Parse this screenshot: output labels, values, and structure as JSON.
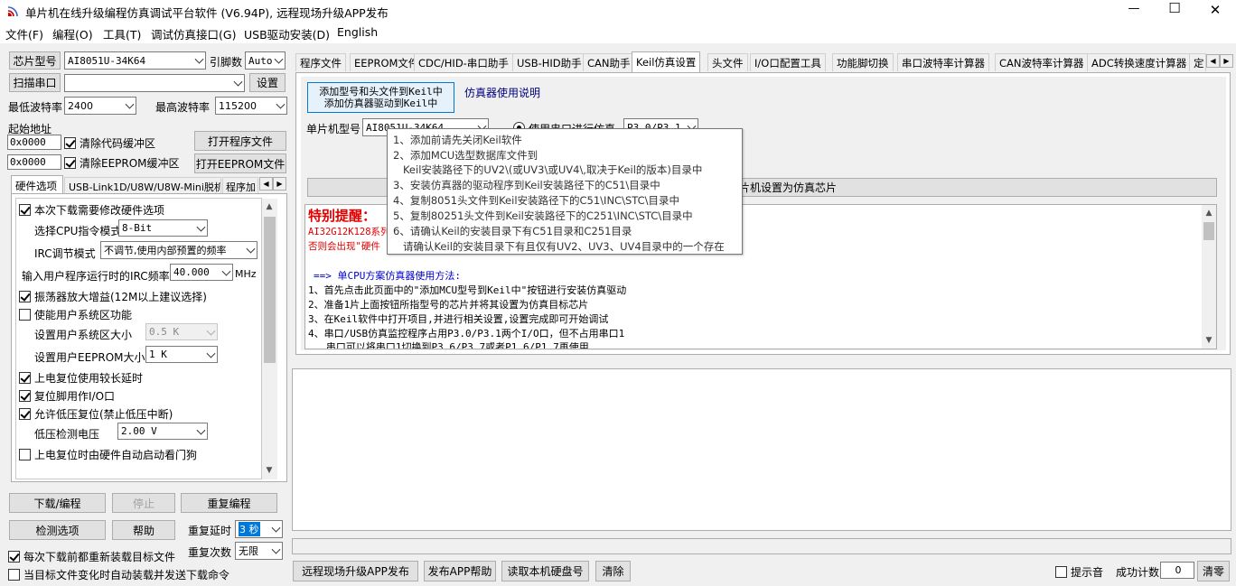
{
  "window": {
    "title": "单片机在线升级编程仿真调试平台软件 (V6.94P), 远程现场升级APP发布",
    "minimize": "—",
    "maximize": "☐",
    "close": "✕"
  },
  "menu": [
    "文件(F)",
    "编程(O)",
    "工具(T)",
    "调试仿真接口(G)",
    "USB驱动安装(D)",
    "English"
  ],
  "left": {
    "chip_label": "芯片型号",
    "chip_value": "AI8051U-34K64",
    "pins_label": "引脚数",
    "pins_value": "Auto",
    "scan_port": "扫描串口",
    "port_value": "",
    "settings": "设置",
    "min_baud_label": "最低波特率",
    "min_baud": "2400",
    "max_baud_label": "最高波特率",
    "max_baud": "115200",
    "start_addr_label": "起始地址",
    "code_addr": "0x0000",
    "clear_code": "清除代码缓冲区",
    "open_program": "打开程序文件",
    "eeprom_addr": "0x0000",
    "clear_eeprom": "清除EEPROM缓冲区",
    "open_eeprom": "打开EEPROM文件",
    "subtabs": [
      "硬件选项",
      "USB-Link1D/U8W/U8W-Mini脱机",
      "程序加"
    ],
    "hw": {
      "modify": "本次下载需要修改硬件选项",
      "cpu_mode_label": "选择CPU指令模式",
      "cpu_mode": "8-Bit",
      "irc_label": "IRC调节模式",
      "irc_value": "不调节,使用内部预置的频率",
      "freq_label": "输入用户程序运行时的IRC频率",
      "freq_value": "40.000",
      "freq_unit": "MHz",
      "osc_gain": "振荡器放大增益(12M以上建议选择)",
      "user_sys": "使能用户系统区功能",
      "sys_size_label": "设置用户系统区大小",
      "sys_size": "0.5 K",
      "eeprom_size_label": "设置用户EEPROM大小",
      "eeprom_size": "1  K",
      "long_delay": "上电复位使用较长延时",
      "reset_io": "复位脚用作I/O口",
      "low_volt_reset": "允许低压复位(禁止低压中断)",
      "low_volt_label": "低压检测电压",
      "low_volt": "2.00 V",
      "watchdog": "上电复位时由硬件自动启动看门狗"
    },
    "download": "下载/编程",
    "stop": "停止",
    "reprogram": "重复编程",
    "check": "检测选项",
    "help": "帮助",
    "delay_label": "重复延时",
    "delay_value": "3 秒",
    "count_label": "重复次数",
    "count_value": "无限",
    "reload": "每次下载前都重新装载目标文件",
    "auto_send": "当目标文件变化时自动装载并发送下载命令"
  },
  "tabs": [
    "程序文件",
    "EEPROM文件",
    "CDC/HID-串口助手",
    "USB-HID助手",
    "CAN助手",
    "Keil仿真设置",
    "头文件",
    "I/O口配置工具",
    "功能脚切换",
    "串口波特率计算器",
    "CAN波特率计算器",
    "ADC转换速度计算器",
    "定"
  ],
  "keil": {
    "add_btn_line1": "添加型号和头文件到Keil中",
    "add_btn_line2": "添加仿真器驱动到Keil中",
    "usage_link": "仿真器使用说明",
    "mcu_label": "单片机型号",
    "mcu_value": "AI8051U-34K64",
    "serial_label": "使用串口进行仿真",
    "serial_value": "P3.0/P3.1",
    "set_chip_text": "片机设置为仿真芯片",
    "notice_title": "特别提醒：",
    "notice_line1": "AI32G12K128系列",
    "notice_line2": "否则会出现\"硬件",
    "method_title": "==> 单CPU方案仿真器使用方法:",
    "methods": [
      "1、首先点击此页面中的\"添加MCU型号到Keil中\"按钮进行安装仿真驱动",
      "2、准备1片上面按钮所指型号的芯片并将其设置为仿真目标芯片",
      "3、在Keil软件中打开项目,并进行相关设置,设置完成即可开始调试",
      "4、串口/USB仿真监控程序占用P3.0/P3.1两个I/O口，但不占用串口1",
      "   串口可以将串口1切换到P3.6/P3.7或者P1.6/P1.7再使用"
    ]
  },
  "tooltip": [
    "1、添加前请先关闭Keil软件",
    "2、添加MCU选型数据库文件到",
    "   Keil安装路径下的UV2\\(或UV3\\或UV4\\,取决于Keil的版本)目录中",
    "3、安装仿真器的驱动程序到Keil安装路径下的C51\\目录中",
    "4、复制8051头文件到Keil安装路径下的C51\\INC\\STC\\目录中",
    "5、复制80251头文件到Keil安装路径下的C251\\INC\\STC\\目录中",
    "6、请确认Keil的安装目录下有C51目录和C251目录",
    "   请确认Keil的安装目录下有且仅有UV2、UV3、UV4目录中的一个存在"
  ],
  "bottom": {
    "remote_upgrade": "远程现场升级APP发布",
    "publish_help": "发布APP帮助",
    "read_disk": "读取本机硬盘号",
    "clear": "清除",
    "beep_label": "提示音",
    "success_label": "成功计数",
    "success_count": "0",
    "reset_count": "清零"
  },
  "colors": {
    "notice_red": "#e00000",
    "link_blue": "#000080",
    "method_blue": "#0000cc",
    "selection_blue": "#0078d7"
  }
}
